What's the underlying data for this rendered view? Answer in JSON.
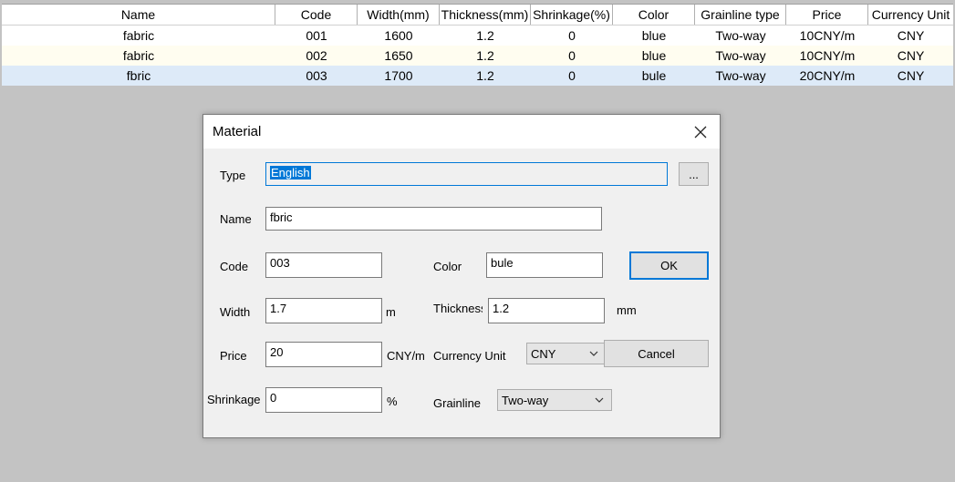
{
  "table": {
    "headers": [
      "Name",
      "Code",
      "Width(mm)",
      "Thickness(mm)",
      "Shrinkage(%)",
      "Color",
      "Grainline type",
      "Price",
      "Currency Unit"
    ],
    "rows": [
      [
        "fabric",
        "001",
        "1600",
        "1.2",
        "0",
        "blue",
        "Two-way",
        "10CNY/m",
        "CNY"
      ],
      [
        "fabric",
        "002",
        "1650",
        "1.2",
        "0",
        "blue",
        "Two-way",
        "10CNY/m",
        "CNY"
      ],
      [
        "fbric",
        "003",
        "1700",
        "1.2",
        "0",
        "bule",
        "Two-way",
        "20CNY/m",
        "CNY"
      ]
    ],
    "selected_row": 2
  },
  "dialog": {
    "title": "Material",
    "labels": {
      "type": "Type",
      "name": "Name",
      "code": "Code",
      "color": "Color",
      "width": "Width",
      "thickness": "Thickness",
      "price": "Price",
      "currency_unit": "Currency Unit",
      "shrinkage": "Shrinkage",
      "grainline": "Grainline"
    },
    "units": {
      "width": "m",
      "thickness": "mm",
      "price": "CNY/m",
      "shrinkage": "%"
    },
    "values": {
      "type": "English",
      "name": "fbric",
      "code": "003",
      "color": "bule",
      "width": "1.7",
      "thickness": "1.2",
      "price": "20",
      "currency_unit": "CNY",
      "shrinkage": "0",
      "grainline": "Two-way"
    },
    "buttons": {
      "browse": "...",
      "ok": "OK",
      "cancel": "Cancel"
    }
  },
  "colors": {
    "accent": "#0078d7",
    "background": "#c3c3c3",
    "dialog_bg": "#f0f0f0"
  }
}
